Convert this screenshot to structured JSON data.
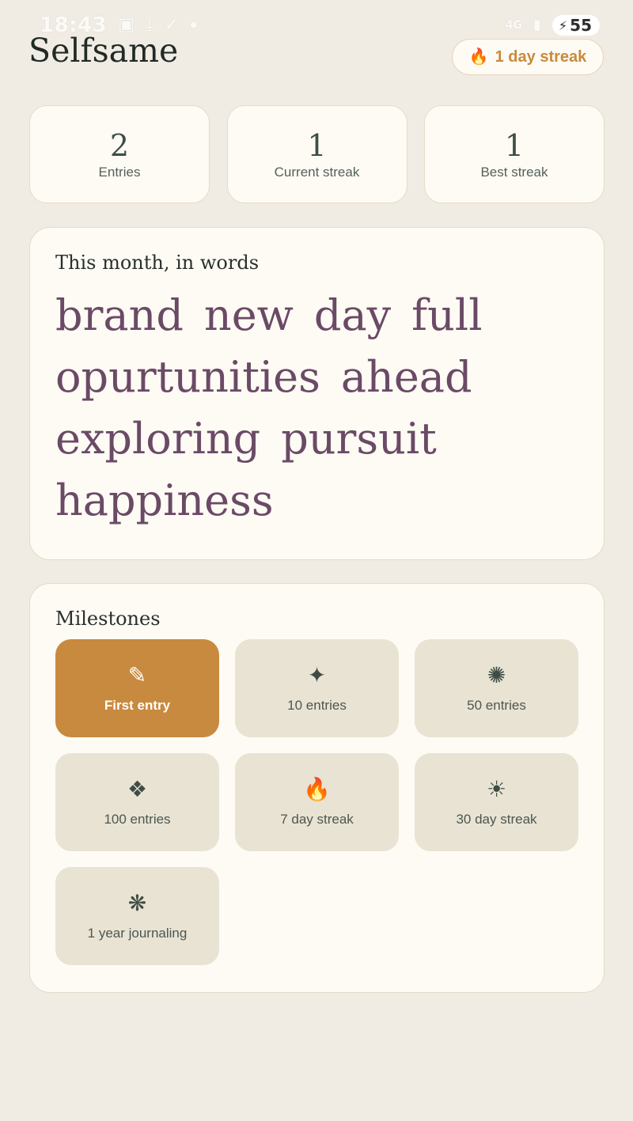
{
  "status_bar": {
    "time": "18:43",
    "icons": [
      "screenshot-icon",
      "download-icon",
      "check-icon",
      "dot-icon"
    ],
    "network": "4G",
    "battery_level": "55"
  },
  "header": {
    "app_title": "Selfsame",
    "streak_pill": {
      "icon": "flame-icon",
      "label": "1 day streak"
    }
  },
  "stats": [
    {
      "value": "2",
      "label": "Entries"
    },
    {
      "value": "1",
      "label": "Current streak"
    },
    {
      "value": "1",
      "label": "Best streak"
    }
  ],
  "words_card": {
    "title": "This month, in words",
    "words": [
      "brand",
      "new",
      "day",
      "full",
      "opurtunities",
      "ahead",
      "exploring",
      "pursuit",
      "happiness"
    ]
  },
  "milestones": {
    "title": "Milestones",
    "items": [
      {
        "icon": "pencil-icon",
        "glyph": "✎",
        "label": "First entry",
        "achieved": true
      },
      {
        "icon": "sparkle-icon",
        "glyph": "✦",
        "label": "10 entries",
        "achieved": false
      },
      {
        "icon": "starburst-icon",
        "glyph": "✺",
        "label": "50 entries",
        "achieved": false
      },
      {
        "icon": "diamonds-icon",
        "glyph": "❖",
        "label": "100 entries",
        "achieved": false
      },
      {
        "icon": "flame-icon",
        "glyph": "🔥",
        "label": "7 day streak",
        "achieved": false
      },
      {
        "icon": "sun-icon",
        "glyph": "☀",
        "label": "30 day streak",
        "achieved": false
      },
      {
        "icon": "asterisk-icon",
        "glyph": "❋",
        "label": "1 year journaling",
        "achieved": false
      }
    ]
  },
  "colors": {
    "background": "#f0ece4",
    "card": "#fdfbf4",
    "accent": "#c88a3f",
    "word": "#6b4a66",
    "milestone_locked": "#e8e3d3"
  }
}
